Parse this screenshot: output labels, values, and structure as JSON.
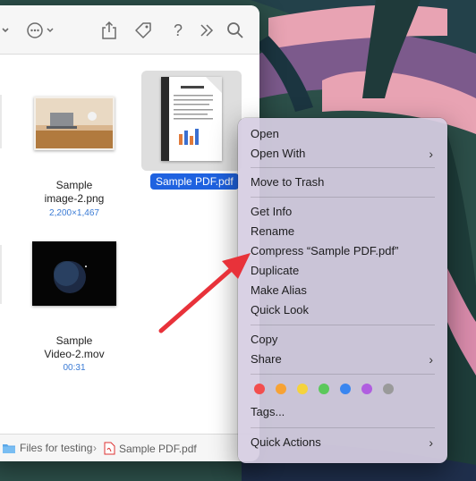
{
  "finder": {
    "toolbar": {
      "action_icon": "ellipsis-circle-icon",
      "share_icon": "share-icon",
      "tag_icon": "tag-icon",
      "help_icon": "question-mark-icon",
      "more_icon": "chevron-double-right-icon",
      "search_icon": "search-icon"
    },
    "items": [
      {
        "name_line1": "Sample",
        "name_line2": "image-2.png",
        "detail": "2,200×1,467"
      },
      {
        "name": "Sample PDF.pdf",
        "selected": true
      },
      {
        "name_line1": "Sample",
        "name_line2": "Video-2.mov",
        "detail": "00:31"
      }
    ],
    "pathbar": {
      "folder": "Files for testing",
      "separator": "›",
      "file": "Sample PDF.pdf"
    }
  },
  "context_menu": {
    "open": "Open",
    "open_with": "Open With",
    "move_to_trash": "Move to Trash",
    "get_info": "Get Info",
    "rename": "Rename",
    "compress": "Compress “Sample PDF.pdf”",
    "duplicate": "Duplicate",
    "make_alias": "Make Alias",
    "quick_look": "Quick Look",
    "copy": "Copy",
    "share": "Share",
    "tags": "Tags...",
    "quick_actions": "Quick Actions",
    "submenu_chevron": "›",
    "tag_colors": [
      "#f24e4e",
      "#f7a234",
      "#f5d33c",
      "#5bc85b",
      "#3a86f0",
      "#b05ee0",
      "#9a9a9a"
    ]
  },
  "annotation": {
    "arrow_color": "#e8323a"
  }
}
